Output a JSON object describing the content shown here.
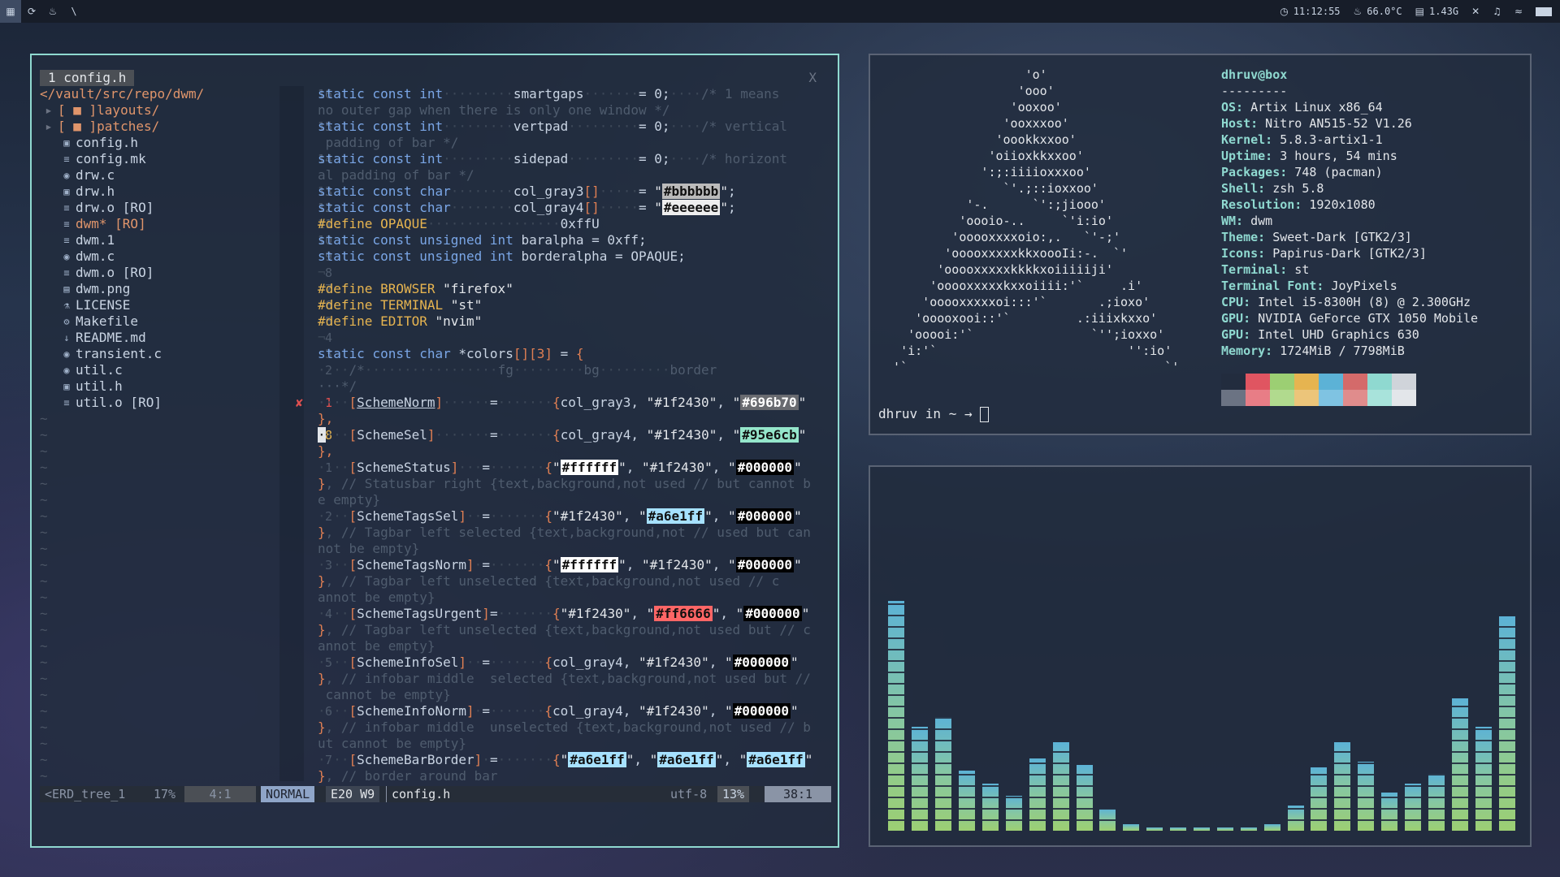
{
  "topbar": {
    "icons": [
      "terminal-icon",
      "refresh-icon",
      "flame-icon",
      "backslash-icon"
    ],
    "tag_backslash": "\\",
    "clock": "11:12:55",
    "temperature": "66.0°C",
    "memory": "1.43G"
  },
  "vim": {
    "tab_label": "1 config.h",
    "tab_close": "X",
    "nerdtree": {
      "root": "</vault/src/repo/dwm/",
      "dirs": [
        "[ ■ ]layouts/",
        "[ ■ ]patches/"
      ],
      "files": [
        "config.h",
        "config.mk",
        "drw.c",
        "drw.h",
        "drw.o [RO]",
        "dwm* [RO]",
        "dwm.1",
        "dwm.c",
        "dwm.o [RO]",
        "dwm.png",
        "LICENSE",
        "Makefile",
        "README.md",
        "transient.c",
        "util.c",
        "util.h",
        "util.o [RO]"
      ]
    },
    "gutter": [
      "16",
      "",
      "15",
      "",
      "14",
      "",
      "13",
      "12",
      "11",
      "10",
      "9",
      "8",
      "7",
      "6",
      "5",
      "4",
      "3",
      "2",
      "",
      "1",
      "",
      "38",
      "",
      "1",
      "",
      "",
      "2",
      "",
      "",
      "3",
      "",
      "",
      "4",
      "",
      "",
      "5",
      "",
      "",
      "6",
      "",
      "",
      "7",
      ""
    ],
    "statusline": {
      "left": "<ERD_tree_1",
      "left_pct": "17%",
      "left_pos": "4:1",
      "mode": "NORMAL",
      "diag": "E20 W9",
      "file": "config.h",
      "encoding": "utf-8",
      "pct": "13%",
      "pos": "38:1"
    }
  },
  "neofetch": {
    "ascii": "                    'o'\n                   'ooo'\n                  'ooxoo'\n                 'ooxxxoo'\n                'oookkxxoo'\n               'oiioxkkxxoo'\n              ':;:iiiioxxxoo'\n                 `'.;::ioxxoo'\n            '-.      `':;jiooo'\n           'oooio-..     `'i:io'\n          'ooooxxxxoio:,.   `'-;'\n         'ooooxxxxxkkxoooIi:-.  `'\n        'ooooxxxxxkkkkxoiiiiiji'\n       'ooooxxxxxkxxoiiii:'`     .i'\n      'ooooxxxxxoi:::'`       .;ioxo'\n     'ooooxooi::'`         .:iiixkxxo'\n    'ooooi:'`                `'';ioxxo'\n   'i:'`                          '':io'\n  '`                                   `'",
    "user": "dhruv@box",
    "sep": "---------",
    "info": [
      {
        "key": "OS:",
        "value": " Artix Linux x86_64"
      },
      {
        "key": "Host:",
        "value": " Nitro AN515-52 V1.26"
      },
      {
        "key": "Kernel:",
        "value": " 5.8.3-artix1-1"
      },
      {
        "key": "Uptime:",
        "value": " 3 hours, 54 mins"
      },
      {
        "key": "Packages:",
        "value": " 748 (pacman)"
      },
      {
        "key": "Shell:",
        "value": " zsh 5.8"
      },
      {
        "key": "Resolution:",
        "value": " 1920x1080"
      },
      {
        "key": "WM:",
        "value": " dwm"
      },
      {
        "key": "Theme:",
        "value": " Sweet-Dark [GTK2/3]"
      },
      {
        "key": "Icons:",
        "value": " Papirus-Dark [GTK2/3]"
      },
      {
        "key": "Terminal:",
        "value": " st"
      },
      {
        "key": "Terminal Font:",
        "value": " JoyPixels"
      },
      {
        "key": "CPU:",
        "value": " Intel i5-8300H (8) @ 2.300GHz"
      },
      {
        "key": "GPU:",
        "value": " NVIDIA GeForce GTX 1050 Mobile"
      },
      {
        "key": "GPU:",
        "value": " Intel UHD Graphics 630"
      },
      {
        "key": "Memory:",
        "value": " 1724MiB / 7798MiB"
      }
    ],
    "palette_top": [
      "#222c3e",
      "#e05561",
      "#9ccf73",
      "#e6b450",
      "#5cb2d6",
      "#d46a6a",
      "#8fd9d0",
      "#d0d4da"
    ],
    "palette_bottom": [
      "#6b7383",
      "#e87d86",
      "#b1da8e",
      "#ecc57a",
      "#7fc3e2",
      "#e08c8c",
      "#a8e3db",
      "#e3e6ea"
    ],
    "prompt": "dhruv in ~ → "
  },
  "cava": {
    "levels": [
      0.73,
      0.33,
      0.36,
      0.19,
      0.15,
      0.11,
      0.23,
      0.28,
      0.21,
      0.07,
      0.02,
      0.01,
      0.01,
      0.01,
      0.01,
      0.01,
      0.02,
      0.08,
      0.2,
      0.28,
      0.22,
      0.12,
      0.15,
      0.18,
      0.42,
      0.33,
      0.68
    ]
  }
}
